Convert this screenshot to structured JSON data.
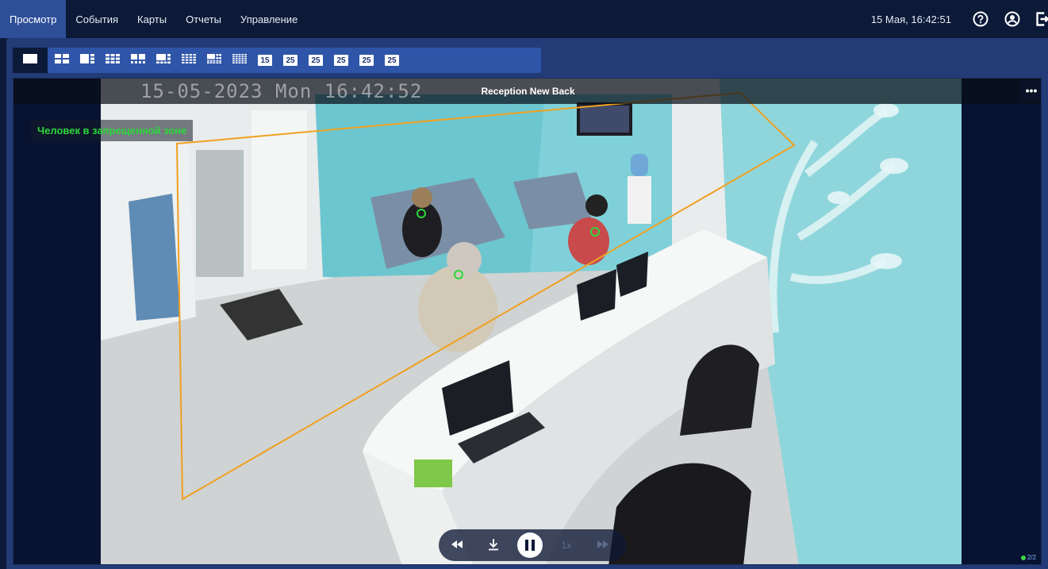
{
  "nav": {
    "items": [
      {
        "label": "Просмотр",
        "active": true
      },
      {
        "label": "События",
        "active": false
      },
      {
        "label": "Карты",
        "active": false
      },
      {
        "label": "Отчеты",
        "active": false
      },
      {
        "label": "Управление",
        "active": false
      }
    ],
    "datetime": "15 Мая, 16:42:51",
    "icons": [
      "help-icon",
      "user-icon",
      "logout-icon"
    ]
  },
  "layouts": {
    "active_index": 0,
    "icons": [
      "layout-1-icon",
      "layout-2x2-icon",
      "layout-1-plus-3-icon",
      "layout-3x3-icon",
      "layout-2-plus-8-icon",
      "layout-1-plus-7-icon",
      "layout-4x4-icon",
      "layout-1-plus-12-icon",
      "layout-5x5-icon"
    ],
    "numbered": [
      "15",
      "25",
      "25",
      "25",
      "25",
      "25"
    ]
  },
  "camera": {
    "title": "Reception New Back",
    "osd_timestamp": "15-05-2023 Mon 16:42:52",
    "alert": "Человек в запрещенной зоне",
    "menu_label": "•••",
    "zone_color": "#f0a020",
    "detection_color": "#2bd83a"
  },
  "playback": {
    "speed": "1x",
    "state": "playing"
  },
  "pager": {
    "label": "2/2"
  }
}
